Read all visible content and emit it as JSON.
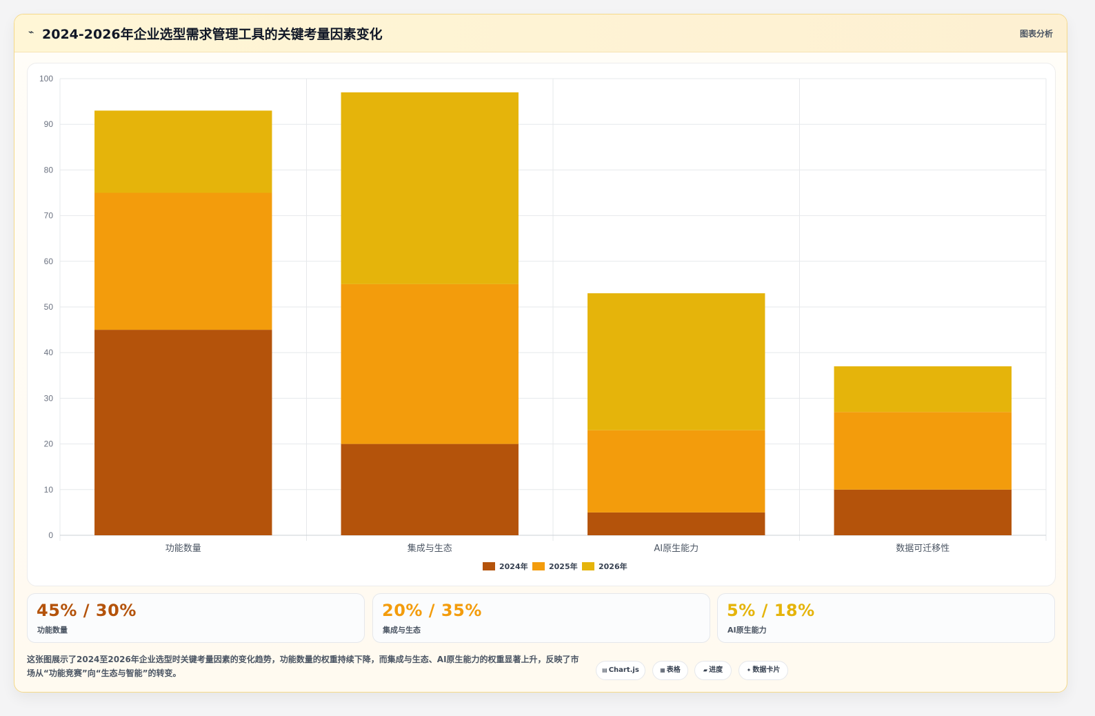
{
  "header": {
    "icon": "trend-icon",
    "icon_glyph": "⌁",
    "title": "2024-2026年企业选型需求管理工具的关键考量因素变化",
    "tag": "图表分析"
  },
  "chart_data": {
    "type": "bar",
    "stacked": true,
    "categories": [
      "功能数量",
      "集成与生态",
      "AI原生能力",
      "数据可迁移性"
    ],
    "series": [
      {
        "name": "2024年",
        "values": [
          45,
          20,
          5,
          10
        ],
        "color": "#b4530b"
      },
      {
        "name": "2025年",
        "values": [
          30,
          35,
          18,
          17
        ],
        "color": "#f39c0c"
      },
      {
        "name": "2026年",
        "values": [
          18,
          42,
          30,
          10
        ],
        "color": "#e5b40b"
      }
    ],
    "ylim": [
      0,
      100
    ],
    "yticks": [
      0,
      10,
      20,
      30,
      40,
      50,
      60,
      70,
      80,
      90,
      100
    ],
    "grid": true,
    "legend_position": "bottom"
  },
  "stats": [
    {
      "value": "45% / 30%",
      "label": "功能数量",
      "color": "#b4530b"
    },
    {
      "value": "20% / 35%",
      "label": "集成与生态",
      "color": "#f39c0c"
    },
    {
      "value": "5% / 18%",
      "label": "AI原生能力",
      "color": "#e5b40b"
    }
  ],
  "footer": {
    "description": "这张图展示了2024至2026年企业选型时关键考量因素的变化趋势，功能数量的权重持续下降，而集成与生态、AI原生能力的权重显著上升，反映了市场从“功能竞赛”向“生态与智能”的转变。",
    "pills": [
      {
        "icon": "chart-icon",
        "glyph": "▤",
        "label": "Chart.js"
      },
      {
        "icon": "table-icon",
        "glyph": "▦",
        "label": "表格"
      },
      {
        "icon": "progress-icon",
        "glyph": "▰",
        "label": "进度"
      },
      {
        "icon": "sparkle-icon",
        "glyph": "✦",
        "label": "数据卡片"
      }
    ]
  }
}
